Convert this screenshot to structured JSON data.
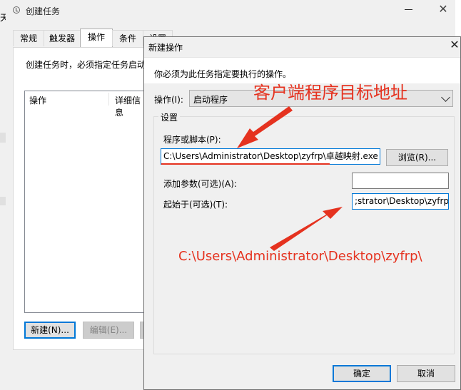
{
  "back_window": {
    "title": "创建任务",
    "tabs": [
      "常规",
      "触发器",
      "操作",
      "条件",
      "设置"
    ],
    "active_tab": "操作",
    "description": "创建任务时，必须指定任务启动",
    "list_headers": [
      "操作",
      "详细信息"
    ],
    "buttons": {
      "new": "新建(N)...",
      "edit": "编辑(E)..."
    },
    "side_fragment": "天"
  },
  "dialog": {
    "title": "新建操作",
    "intro": "你必须为此任务指定要执行的操作。",
    "action_label": "操作(I):",
    "action_value": "启动程序",
    "settings_group": "设置",
    "program_label": "程序或脚本(P):",
    "program_value": "C:\\Users\\Administrator\\Desktop\\zyfrp\\卓越映射.exe",
    "browse_button": "浏览(R)...",
    "args_label": "添加参数(可选)(A):",
    "args_value": "",
    "start_in_label": "起始于(可选)(T):",
    "start_in_value": ";strator\\Desktop\\zyfrp\\",
    "ok_button": "确定",
    "cancel_button": "取消"
  },
  "annotations": {
    "client_path_title": "客户端程序目标地址",
    "start_in_path": "C:\\Users\\Administrator\\Desktop\\zyfrp\\",
    "color": "#e5321f"
  }
}
